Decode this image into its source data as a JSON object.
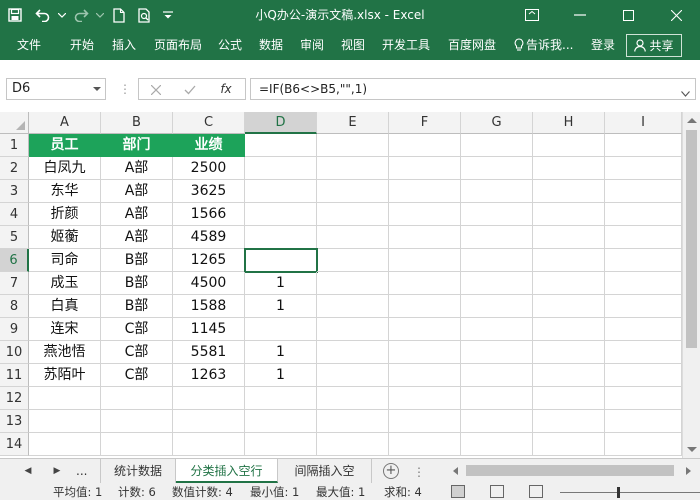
{
  "window": {
    "title": "小Q办公-演示文稿.xlsx - Excel"
  },
  "icons": {
    "save": "save-icon",
    "undo": "undo-icon",
    "redo": "redo-icon",
    "new": "new-file-icon",
    "print_preview": "print-preview-icon",
    "customize": "customize-qat-icon",
    "ribbon_options": "ribbon-display-icon",
    "minimize": "minimize-icon",
    "maximize": "maximize-icon",
    "close": "close-icon",
    "cancel": "cancel-icon",
    "enter": "check-icon",
    "fx": "fx-icon"
  },
  "menu": {
    "items": [
      "文件",
      "开始",
      "插入",
      "页面布局",
      "公式",
      "数据",
      "审阅",
      "视图",
      "开发工具",
      "百度网盘"
    ],
    "tell_me": "告诉我...",
    "login": "登录",
    "share": "共享"
  },
  "formula_bar": {
    "name_box": "D6",
    "fx_label": "fx",
    "formula": "=IF(B6<>B5,\"\",1)"
  },
  "grid": {
    "columns": [
      "A",
      "B",
      "C",
      "D",
      "E",
      "F",
      "G",
      "H",
      "I"
    ],
    "rows": [
      "1",
      "2",
      "3",
      "4",
      "5",
      "6",
      "7",
      "8",
      "9",
      "10",
      "11",
      "12",
      "13",
      "14"
    ],
    "header": [
      "员工",
      "部门",
      "业绩"
    ],
    "data": [
      [
        "白凤九",
        "A部",
        "2500",
        ""
      ],
      [
        "东华",
        "A部",
        "3625",
        ""
      ],
      [
        "折颜",
        "A部",
        "1566",
        ""
      ],
      [
        "姬蘅",
        "A部",
        "4589",
        ""
      ],
      [
        "司命",
        "B部",
        "1265",
        ""
      ],
      [
        "成玉",
        "B部",
        "4500",
        "1"
      ],
      [
        "白真",
        "B部",
        "1588",
        "1"
      ],
      [
        "连宋",
        "C部",
        "1145",
        ""
      ],
      [
        "燕池悟",
        "C部",
        "5581",
        "1"
      ],
      [
        "苏陌叶",
        "C部",
        "1263",
        "1"
      ]
    ],
    "active_cell": "D6"
  },
  "tabs": {
    "more": "...",
    "items": [
      "统计数据",
      "分类插入空行",
      "间隔插入空"
    ],
    "active": 1
  },
  "status": {
    "average": "平均值: 1",
    "count": "计数: 6",
    "numeric_count": "数值计数: 4",
    "min": "最小值: 1",
    "max": "最大值: 1",
    "sum": "求和: 4"
  },
  "colors": {
    "excel_green": "#217346",
    "header_fill": "#1da35a"
  }
}
